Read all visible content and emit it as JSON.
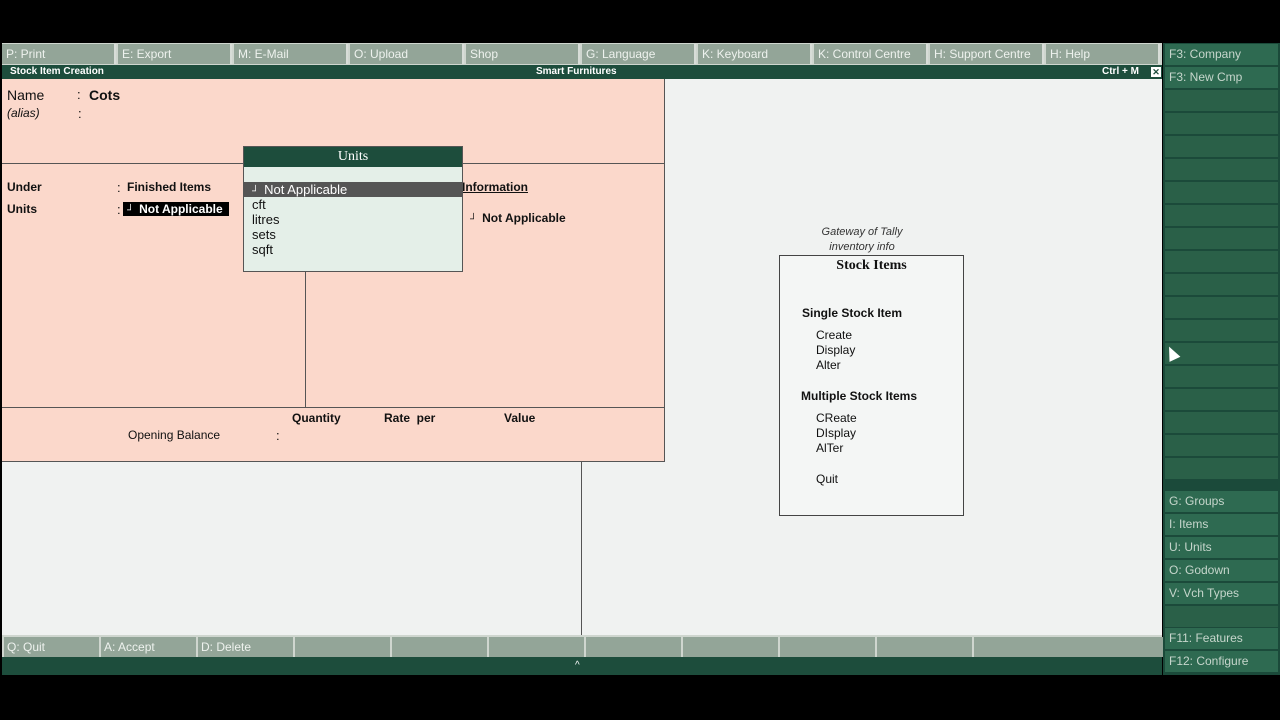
{
  "top_buttons": [
    {
      "label": "P: Print"
    },
    {
      "label": "E: Export"
    },
    {
      "label": "M: E-Mail"
    },
    {
      "label": "O: Upload"
    },
    {
      "label": "Shop"
    },
    {
      "label": "G: Language"
    },
    {
      "label": "K: Keyboard"
    },
    {
      "label": "K: Control Centre"
    },
    {
      "label": "H: Support Centre"
    },
    {
      "label": "H: Help"
    }
  ],
  "titlebar": {
    "left": "Stock Item Creation",
    "middle": "Smart Furnitures",
    "right": "Ctrl + M",
    "close": "✕"
  },
  "form": {
    "name_label": "Name",
    "name_value": "Cots",
    "alias_label": "(alias)",
    "colon": ":",
    "under_label": "Under",
    "under_value": "Finished Items",
    "units_label": "Units",
    "units_value": "Not Applicable",
    "info_header": "Information",
    "info_value": "Not Applicable",
    "qty_header": "Quantity",
    "rate_header": "Rate  per",
    "value_header": "Value",
    "opening_label": "Opening Balance"
  },
  "units_popup": {
    "title": "Units",
    "options": [
      "Not Applicable",
      "cft",
      "litres",
      "sets",
      "sqft"
    ]
  },
  "gateway": {
    "note_line1": "Gateway of Tally",
    "note_line2": "inventory info",
    "title": "Stock Items",
    "single_header": "Single Stock Item",
    "single_items": [
      "Create",
      "Display",
      "Alter"
    ],
    "multi_header": "Multiple Stock Items",
    "multi_items": [
      "CReate",
      "DIsplay",
      "AlTer"
    ],
    "quit": "Quit"
  },
  "right_panel": {
    "company": "F3: Company",
    "new_cmp": "F3: New Cmp",
    "groups": "G: Groups",
    "items": "I: Items",
    "units": "U: Units",
    "godown": "O: Godown",
    "vch_types": "V: Vch Types",
    "features": "F11: Features",
    "configure": "F12: Configure"
  },
  "bottom_buttons": [
    {
      "label": "Q: Quit"
    },
    {
      "label": "A: Accept"
    },
    {
      "label": "D: Delete"
    }
  ],
  "status": {
    "caret": "^"
  }
}
